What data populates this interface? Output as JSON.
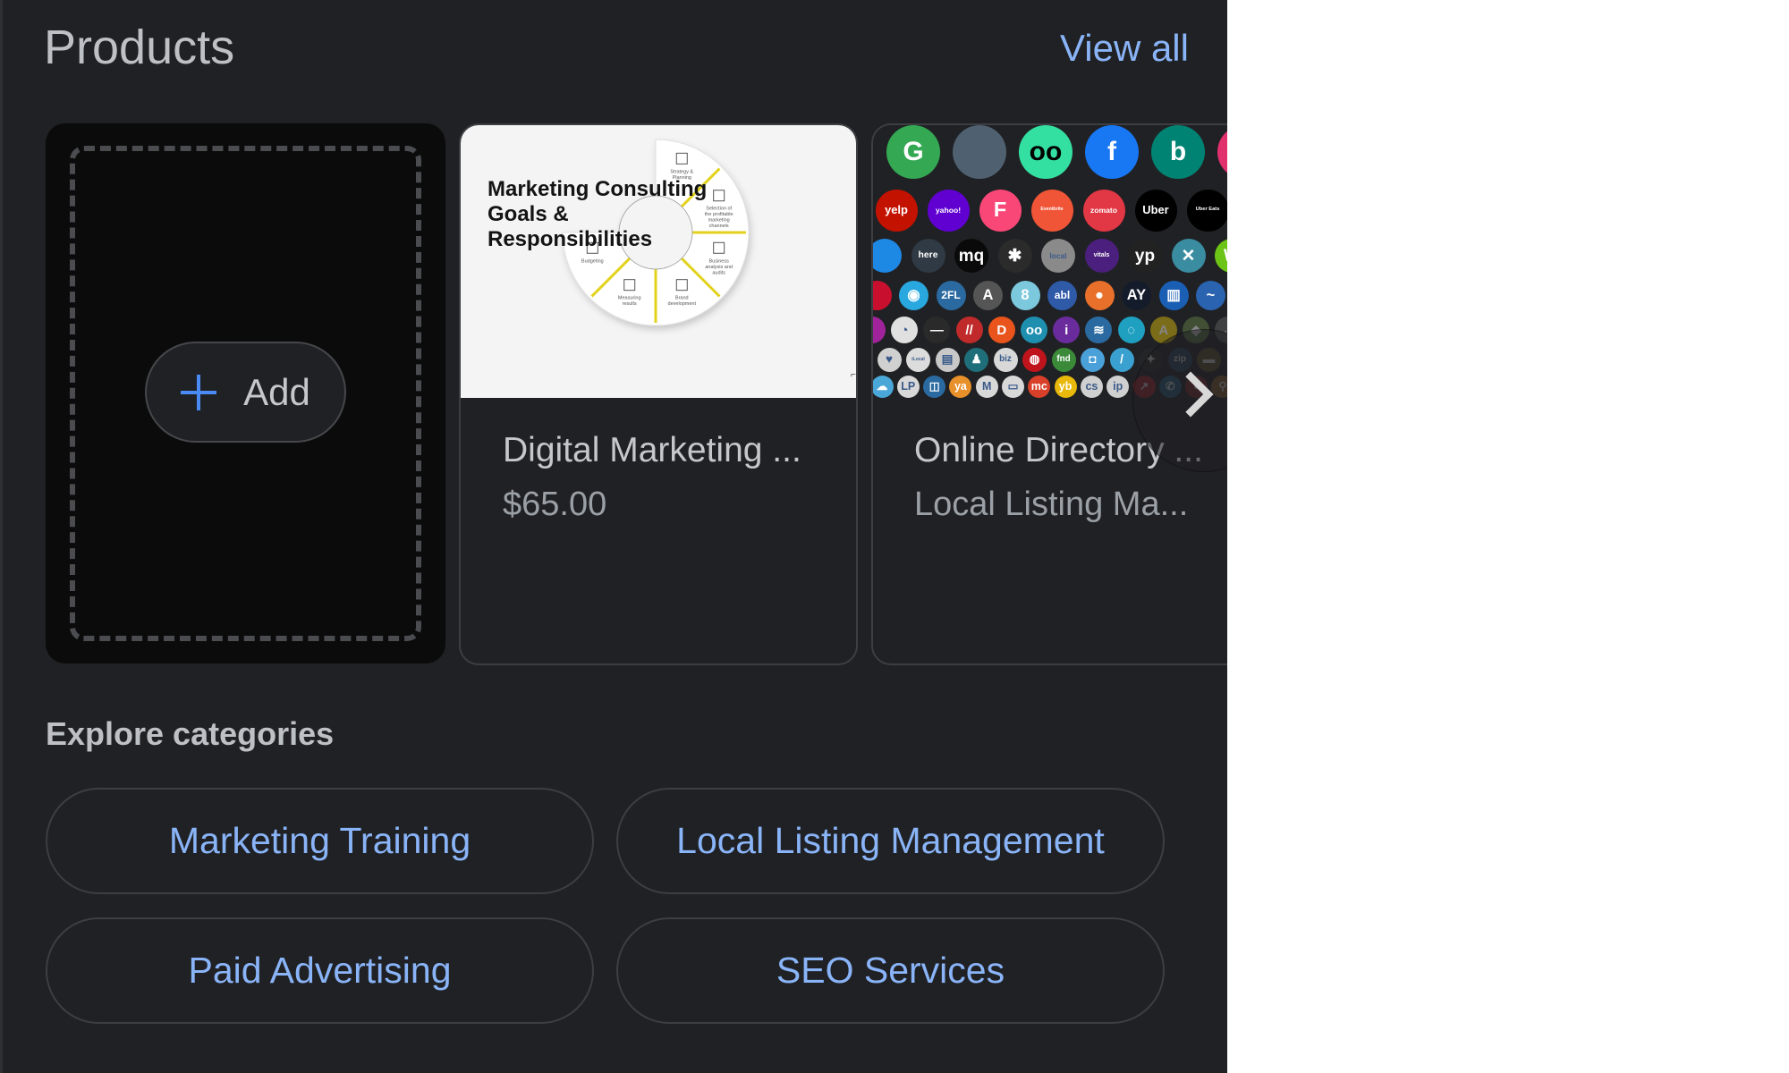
{
  "header": {
    "title": "Products",
    "view_all_label": "View all"
  },
  "colors": {
    "background": "#202124",
    "link": "#8ab4f8",
    "text_primary": "#bdc1c6",
    "text_secondary": "#9aa0a6",
    "add_plus": "#4a8af4"
  },
  "add_card": {
    "button_label": "Add",
    "icon": "plus-icon"
  },
  "products": [
    {
      "name": "Digital Marketing ...",
      "subtitle": "$65.00",
      "image": {
        "type": "diagram",
        "title": "Marketing Consulting Goals & Responsibilities",
        "segments": [
          "Strategy & Planning",
          "Selection of the profitable marketing channels",
          "Business analysis and audits",
          "Brand development",
          "Measuring results",
          "Budgeting"
        ]
      }
    },
    {
      "name": "Online Directory ...",
      "subtitle": "Local Listing Ma...",
      "image": {
        "type": "icon-collage",
        "rows": [
          [
            {
              "name": "google-maps",
              "color": "#34a853",
              "glyph": "G"
            },
            {
              "name": "apple",
              "color": "#4f6070",
              "glyph": ""
            },
            {
              "name": "tripadvisor",
              "color": "#34e0a1",
              "glyph": "oo"
            },
            {
              "name": "facebook",
              "color": "#1877f2",
              "glyph": "f"
            },
            {
              "name": "bing",
              "color": "#008373",
              "glyph": "b"
            },
            {
              "name": "instagram",
              "color": "#e1306c",
              "glyph": ""
            }
          ],
          [
            {
              "name": "yelp",
              "color": "#c41200",
              "glyph": "yelp"
            },
            {
              "name": "yahoo",
              "color": "#6001d2",
              "glyph": "yahoo!"
            },
            {
              "name": "foursquare",
              "color": "#f94877",
              "glyph": "F"
            },
            {
              "name": "eventbrite",
              "color": "#f05537",
              "glyph": "Eventbrite"
            },
            {
              "name": "zomato",
              "color": "#e23744",
              "glyph": "zomato"
            },
            {
              "name": "uber",
              "color": "#000000",
              "glyph": "Uber"
            },
            {
              "name": "uber-eats",
              "color": "#000000",
              "glyph": "Uber Eats"
            }
          ],
          [
            {
              "name": "waze-like",
              "color": "#1e88e5",
              "glyph": ""
            },
            {
              "name": "here",
              "color": "#2f3a44",
              "glyph": "here"
            },
            {
              "name": "mapquest",
              "color": "#0a0a0a",
              "glyph": "mq"
            },
            {
              "name": "frog",
              "color": "#2b2b2b",
              "glyph": "✱"
            },
            {
              "name": "local",
              "color": "#8a8a8a",
              "glyph": "local"
            },
            {
              "name": "vitals",
              "color": "#4b1f7e",
              "glyph": "vitals"
            },
            {
              "name": "yellow-pages",
              "color": "#222222",
              "glyph": "yp"
            },
            {
              "name": "navmii",
              "color": "#3a8da0",
              "glyph": "✕"
            },
            {
              "name": "wikimapia",
              "color": "#6cc417",
              "glyph": "W"
            }
          ],
          [
            {
              "name": "citysearch",
              "color": "#c8102e",
              "glyph": ""
            },
            {
              "name": "hotfrog",
              "color": "#29a8e0",
              "glyph": "◉"
            },
            {
              "name": "2findlocal",
              "color": "#2a6aa0",
              "glyph": "2FL"
            },
            {
              "name": "tupalo",
              "color": "#555555",
              "glyph": "A"
            },
            {
              "name": "8coupons",
              "color": "#7cc8dc",
              "glyph": "8"
            },
            {
              "name": "ablocal",
              "color": "#2e5aa8",
              "glyph": "abl"
            },
            {
              "name": "chamberofcommerce",
              "color": "#e8702a",
              "glyph": "●"
            },
            {
              "name": "airyell",
              "color": "#141c2c",
              "glyph": "AY"
            },
            {
              "name": "brownbook",
              "color": "#1a5fb4",
              "glyph": "▥"
            },
            {
              "name": "cylex",
              "color": "#2a63b0",
              "glyph": "~"
            }
          ],
          [
            {
              "name": "dialo",
              "color": "#a0239b",
              "glyph": ""
            },
            {
              "name": "elocal",
              "color": "#e0e0e0",
              "glyph": "◔"
            },
            {
              "name": "ezlocal",
              "color": "#2a2a2a",
              "glyph": "—"
            },
            {
              "name": "fyple",
              "color": "#c02a2a",
              "glyph": "//"
            },
            {
              "name": "getfave",
              "color": "#e8541c",
              "glyph": "D"
            },
            {
              "name": "iglobal",
              "color": "#1f8fb0",
              "glyph": "oo"
            },
            {
              "name": "infobel",
              "color": "#6a2c9c",
              "glyph": "i"
            },
            {
              "name": "localstack",
              "color": "#2a6aa0",
              "glyph": "≋"
            },
            {
              "name": "mylocalservices",
              "color": "#1fa0c0",
              "glyph": "◌"
            },
            {
              "name": "n49",
              "color": "#e8c80a",
              "glyph": "A"
            },
            {
              "name": "nextdoor",
              "color": "#6a8a4a",
              "glyph": "◆"
            },
            {
              "name": "opendi",
              "color": "#666666",
              "glyph": "..."
            }
          ],
          [
            {
              "name": "showmelocal",
              "color": "#d0d0d0",
              "glyph": "♥"
            },
            {
              "name": "ilocal",
              "color": "#dcdcdc",
              "glyph": "iLocal"
            },
            {
              "name": "storeboard",
              "color": "#c8c8c8",
              "glyph": "▤"
            },
            {
              "name": "tupalo-2",
              "color": "#1f6f7a",
              "glyph": "♟"
            },
            {
              "name": "bizlocal",
              "color": "#d8d8d8",
              "glyph": "biz"
            },
            {
              "name": "cybo",
              "color": "#c0141c",
              "glyph": "◍"
            },
            {
              "name": "fndit",
              "color": "#3a8a3a",
              "glyph": "fnd"
            },
            {
              "name": "dandb",
              "color": "#4aa0d8",
              "glyph": "◘"
            },
            {
              "name": "pinpoint",
              "color": "#3aa0d0",
              "glyph": "/"
            },
            {
              "name": "here-2",
              "color": "#2a2a2a",
              "glyph": "✦"
            },
            {
              "name": "zip",
              "color": "#2a4a6a",
              "glyph": "zip"
            },
            {
              "name": "chat",
              "color": "#6a5a2a",
              "glyph": "▬"
            }
          ],
          [
            {
              "name": "weather",
              "color": "#4aa8d8",
              "glyph": "☁"
            },
            {
              "name": "localpages",
              "color": "#d8d8d8",
              "glyph": "LP"
            },
            {
              "name": "mapsconnect",
              "color": "#2a6aa0",
              "glyph": "◫"
            },
            {
              "name": "yalwa",
              "color": "#e8902a",
              "glyph": "ya"
            },
            {
              "name": "mojopages",
              "color": "#d8d8d8",
              "glyph": "M"
            },
            {
              "name": "merchantcircle",
              "color": "#d8d8d8",
              "glyph": "▭"
            },
            {
              "name": "mc",
              "color": "#d8402a",
              "glyph": "mc"
            },
            {
              "name": "yellowbot",
              "color": "#e8b80a",
              "glyph": "yb"
            },
            {
              "name": "citysquares",
              "color": "#d0d0d0",
              "glyph": "cs"
            },
            {
              "name": "insiderpages",
              "color": "#d0d0d0",
              "glyph": "ip"
            },
            {
              "name": "arrow-link",
              "color": "#c0202a",
              "glyph": "↗"
            },
            {
              "name": "phone",
              "color": "#1f6a8a",
              "glyph": "✆"
            },
            {
              "name": "pin-red",
              "color": "#8a2a2a",
              "glyph": "●"
            },
            {
              "name": "pin-orange",
              "color": "#a06a2a",
              "glyph": "⚲"
            }
          ]
        ]
      }
    }
  ],
  "carousel": {
    "next_icon": "chevron-right-icon"
  },
  "explore": {
    "title": "Explore categories",
    "categories": [
      {
        "label": "Marketing Training"
      },
      {
        "label": "Local Listing Management"
      },
      {
        "label": "Paid Advertising"
      },
      {
        "label": "SEO Services"
      }
    ]
  }
}
